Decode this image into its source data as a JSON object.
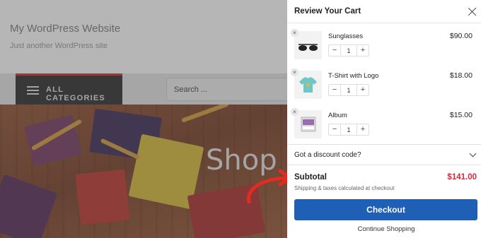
{
  "site": {
    "title": "My WordPress Website",
    "tagline": "Just another WordPress site",
    "categories_label": "ALL CATEGORIES",
    "search": {
      "placeholder": "Search ..."
    },
    "hero_title": "Shop"
  },
  "cart": {
    "title": "Review Your Cart",
    "items": [
      {
        "name": "Sunglasses",
        "price": "$90.00",
        "quantity": "1",
        "icon": "sunglasses-icon"
      },
      {
        "name": "T-Shirt with Logo",
        "price": "$18.00",
        "quantity": "1",
        "icon": "tshirt-icon"
      },
      {
        "name": "Album",
        "price": "$15.00",
        "quantity": "1",
        "icon": "album-icon"
      }
    ],
    "discount_label": "Got a discount code?",
    "subtotal_label": "Subtotal",
    "subtotal_value": "$141.00",
    "shipping_note": "Shipping & taxes calculated at checkout",
    "checkout_label": "Checkout",
    "continue_label": "Continue Shopping",
    "remove_symbol": "×",
    "minus_symbol": "−",
    "plus_symbol": "+"
  },
  "colors": {
    "accent": "#1f5fb6",
    "price_highlight": "#d6293a",
    "category_bar": "#2c2c2c",
    "category_border": "#d63638",
    "arrow": "#e32b1f"
  }
}
